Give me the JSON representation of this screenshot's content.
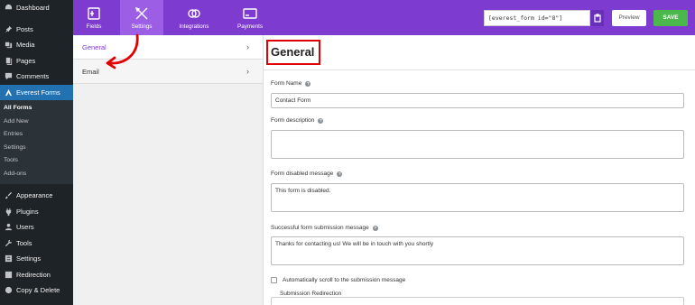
{
  "wp_menu": {
    "items_top": [
      {
        "label": "Dashboard",
        "icon": "dashboard-icon"
      },
      {
        "label": "Posts",
        "icon": "pin-icon"
      },
      {
        "label": "Media",
        "icon": "media-icon"
      },
      {
        "label": "Pages",
        "icon": "pages-icon"
      },
      {
        "label": "Comments",
        "icon": "comment-icon"
      },
      {
        "label": "Everest Forms",
        "icon": "everest-forms-icon"
      }
    ],
    "submenu": [
      "All Forms",
      "Add New",
      "Entries",
      "Settings",
      "Tools",
      "Add-ons"
    ],
    "items_bottom": [
      {
        "label": "Appearance",
        "icon": "brush-icon"
      },
      {
        "label": "Plugins",
        "icon": "plugin-icon"
      },
      {
        "label": "Users",
        "icon": "users-icon"
      },
      {
        "label": "Tools",
        "icon": "wrench-icon"
      },
      {
        "label": "Settings",
        "icon": "settings-icon"
      },
      {
        "label": "Redirection",
        "icon": "redirection-icon"
      },
      {
        "label": "Copy & Delete",
        "icon": "copy-icon"
      }
    ]
  },
  "topbar": {
    "tabs": [
      {
        "label": "Fields",
        "icon": "fields-icon"
      },
      {
        "label": "Settings",
        "icon": "settings-tools-icon"
      },
      {
        "label": "Integrations",
        "icon": "integrations-icon"
      },
      {
        "label": "Payments",
        "icon": "payments-icon"
      }
    ],
    "active_tab": "Settings",
    "shortcode": "[everest_form id=\"8\"]",
    "preview_label": "Preview",
    "save_label": "SAVE"
  },
  "settings_menu": {
    "items": [
      {
        "label": "General",
        "active": true
      },
      {
        "label": "Email",
        "active": false
      }
    ],
    "chevron": "›"
  },
  "main": {
    "title": "General",
    "help_glyph": "?",
    "form_name_label": "Form Name",
    "form_name_value": "Contact Form",
    "form_description_label": "Form description",
    "form_description_value": "",
    "form_disabled_label": "Form disabled message",
    "form_disabled_value": "This form is disabled.",
    "success_label": "Successful form submission message",
    "success_value": "Thanks for contacting us! We will be in touch with you shortly",
    "autoscroll_label": "Automatically scroll to the submission message",
    "redirection_legend": "Submission Redirection"
  },
  "colors": {
    "accent_purple": "#7e3bd0",
    "save_green": "#4cb84c",
    "annotation_red": "#e10000",
    "wp_active_blue": "#2271b1"
  }
}
